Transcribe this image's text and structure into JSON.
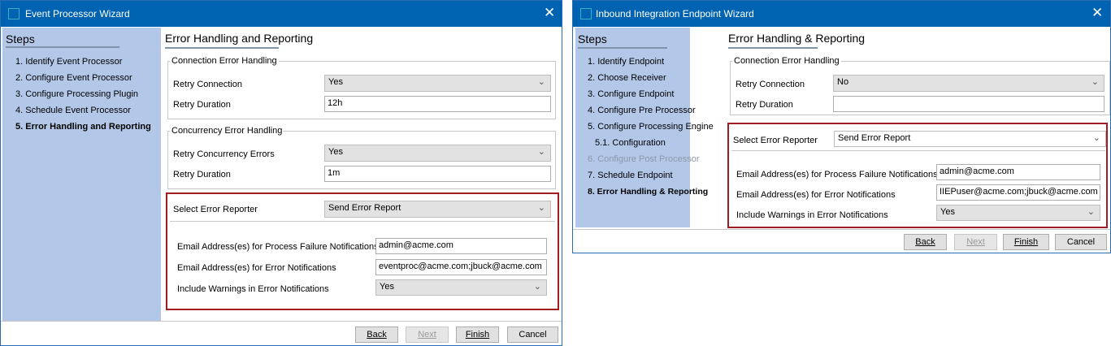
{
  "left": {
    "title": "Event Processor Wizard",
    "steps_title": "Steps",
    "steps": [
      "1. Identify Event Processor",
      "2. Configure Event Processor",
      "3. Configure Processing Plugin",
      "4. Schedule Event Processor",
      "5. Error Handling and Reporting"
    ],
    "header": "Error Handling and Reporting",
    "connection_group": {
      "legend": "Connection Error Handling",
      "retry_label": "Retry Connection",
      "retry_value": "Yes",
      "duration_label": "Retry Duration",
      "duration_value": "12h"
    },
    "concurrency_group": {
      "legend": "Concurrency Error Handling",
      "retry_label": "Retry Concurrency Errors",
      "retry_value": "Yes",
      "duration_label": "Retry Duration",
      "duration_value": "1m"
    },
    "reporter": {
      "label": "Select Error Reporter",
      "value": "Send Error Report",
      "failure_label": "Email Address(es) for Process Failure Notifications",
      "failure_value": "admin@acme.com",
      "error_label": "Email Address(es) for Error Notifications",
      "error_value": "eventproc@acme.com;jbuck@acme.com",
      "warnings_label": "Include Warnings in Error Notifications",
      "warnings_value": "Yes"
    },
    "buttons": {
      "back": "Back",
      "next": "Next",
      "finish": "Finish",
      "cancel": "Cancel"
    }
  },
  "right": {
    "title": "Inbound Integration Endpoint Wizard",
    "steps_title": "Steps",
    "steps": [
      "1. Identify Endpoint",
      "2. Choose Receiver",
      "3. Configure Endpoint",
      "4. Configure Pre Processor",
      "5. Configure Processing Engine",
      "5.1. Configuration",
      "6. Configure Post Processor",
      "7. Schedule Endpoint",
      "8. Error Handling & Reporting"
    ],
    "header": "Error Handling & Reporting",
    "connection_group": {
      "legend": "Connection Error Handling",
      "retry_label": "Retry Connection",
      "retry_value": "No",
      "duration_label": "Retry Duration",
      "duration_value": ""
    },
    "reporter": {
      "label": "Select Error Reporter",
      "value": "Send Error Report",
      "failure_label": "Email Address(es) for Process Failure Notifications",
      "failure_value": "admin@acme.com",
      "error_label": "Email Address(es) for Error Notifications",
      "error_value": "IIEPuser@acme.com;jbuck@acme.com",
      "warnings_label": "Include Warnings in Error Notifications",
      "warnings_value": "Yes"
    },
    "buttons": {
      "back": "Back",
      "next": "Next",
      "finish": "Finish",
      "cancel": "Cancel"
    }
  },
  "icons": {
    "close": "✕",
    "chevron": "⌄"
  },
  "colors": {
    "titlebar": "#0063b1",
    "steps_panel": "#b3c8e8",
    "highlight_box": "#a11d22"
  }
}
